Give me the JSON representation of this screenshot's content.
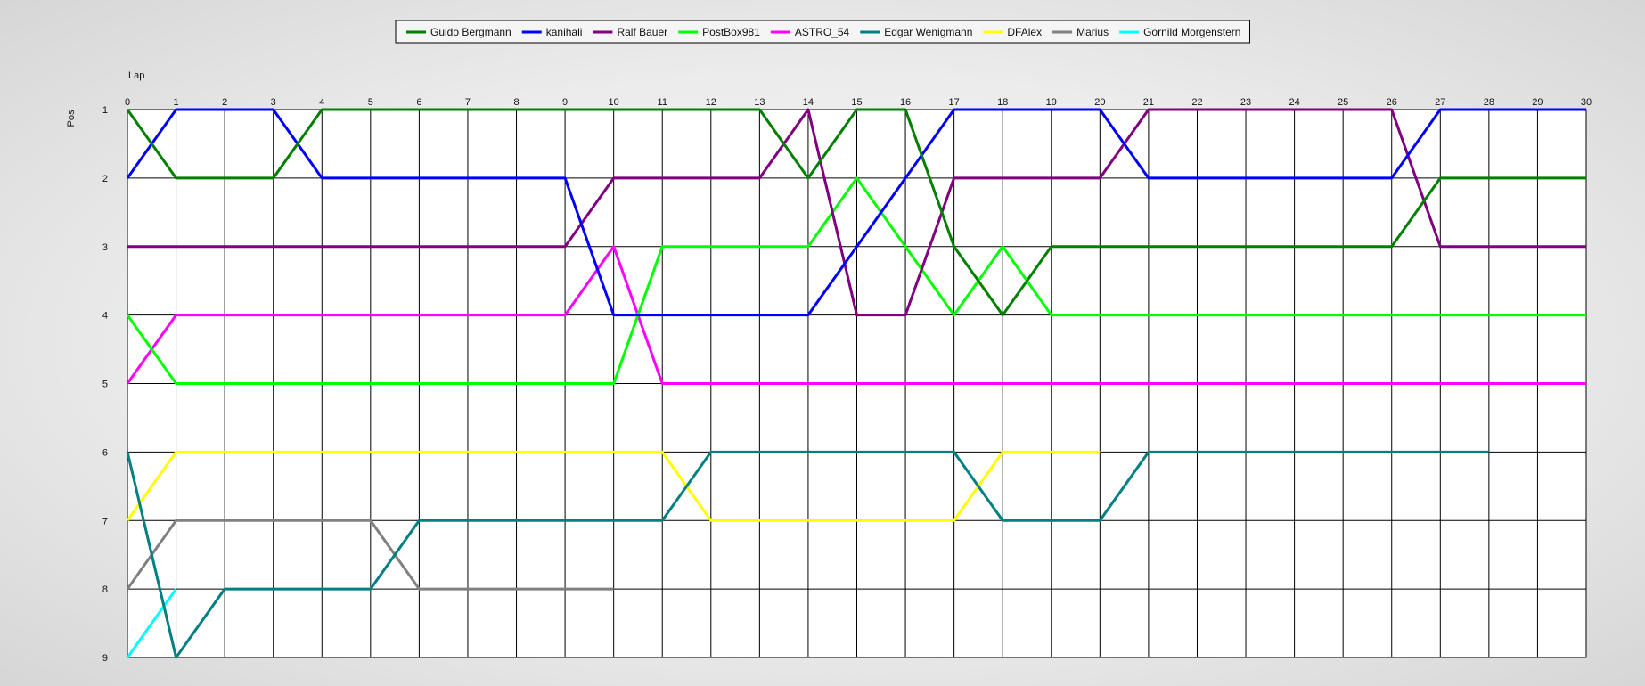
{
  "chart_data": {
    "type": "line",
    "xlabel": "Lap",
    "ylabel": "Pos",
    "xlim": [
      0,
      30
    ],
    "ylim": [
      1,
      9
    ],
    "y_inverted": true,
    "grid": true,
    "legend_position": "top-center",
    "x_ticks": [
      "0",
      "1",
      "2",
      "3",
      "4",
      "5",
      "6",
      "7",
      "8",
      "9",
      "10",
      "11",
      "12",
      "13",
      "14",
      "15",
      "16",
      "17",
      "18",
      "19",
      "20",
      "21",
      "22",
      "23",
      "24",
      "25",
      "26",
      "27",
      "28",
      "29",
      "30"
    ],
    "y_ticks": [
      "1",
      "2",
      "3",
      "4",
      "5",
      "6",
      "7",
      "8",
      "9"
    ],
    "series": [
      {
        "name": "Guido Bergmann",
        "color": "#008000",
        "start_lap": 0,
        "values": [
          1,
          2,
          2,
          2,
          1,
          1,
          1,
          1,
          1,
          1,
          1,
          1,
          1,
          1,
          2,
          1,
          1,
          3,
          4,
          3,
          3,
          3,
          3,
          3,
          3,
          3,
          3,
          2,
          2,
          2,
          2
        ]
      },
      {
        "name": "kanihali",
        "color": "#0000ff",
        "start_lap": 0,
        "values": [
          2,
          1,
          1,
          1,
          2,
          2,
          2,
          2,
          2,
          2,
          4,
          4,
          4,
          4,
          4,
          3,
          2,
          1,
          1,
          1,
          1,
          2,
          2,
          2,
          2,
          2,
          2,
          1,
          1,
          1,
          1
        ]
      },
      {
        "name": "Ralf Bauer",
        "color": "#800080",
        "start_lap": 0,
        "values": [
          3,
          3,
          3,
          3,
          3,
          3,
          3,
          3,
          3,
          3,
          2,
          2,
          2,
          2,
          1,
          4,
          4,
          2,
          2,
          2,
          2,
          1,
          1,
          1,
          1,
          1,
          1,
          3,
          3,
          3,
          3
        ]
      },
      {
        "name": "PostBox981",
        "color": "#00ff00",
        "start_lap": 0,
        "values": [
          4,
          5,
          5,
          5,
          5,
          5,
          5,
          5,
          5,
          5,
          5,
          3,
          3,
          3,
          3,
          2,
          3,
          4,
          3,
          4,
          4,
          4,
          4,
          4,
          4,
          4,
          4,
          4,
          4,
          4,
          4
        ]
      },
      {
        "name": "ASTRO_54",
        "color": "#ff00ff",
        "start_lap": 0,
        "values": [
          5,
          4,
          4,
          4,
          4,
          4,
          4,
          4,
          4,
          4,
          3,
          5,
          5,
          5,
          5,
          5,
          5,
          5,
          5,
          5,
          5,
          5,
          5,
          5,
          5,
          5,
          5,
          5,
          5,
          5,
          5
        ]
      },
      {
        "name": "Edgar Wenigmann",
        "color": "#008080",
        "start_lap": 0,
        "values": [
          6,
          9,
          8,
          8,
          8,
          8,
          7,
          7,
          7,
          7,
          7,
          7,
          6,
          6,
          6,
          6,
          6,
          6,
          7,
          7,
          7,
          6,
          6,
          6,
          6,
          6,
          6,
          6,
          6
        ]
      },
      {
        "name": "DFAlex",
        "color": "#ffff00",
        "start_lap": 0,
        "values": [
          7,
          6,
          6,
          6,
          6,
          6,
          6,
          6,
          6,
          6,
          6,
          6,
          7,
          7,
          7,
          7,
          7,
          7,
          6,
          6,
          6
        ]
      },
      {
        "name": "Marius",
        "color": "#808080",
        "start_lap": 0,
        "values": [
          8,
          7,
          7,
          7,
          7,
          7,
          8,
          8,
          8,
          8,
          8
        ]
      },
      {
        "name": "Gornild Morgenstern",
        "color": "#00ffff",
        "start_lap": 0,
        "values": [
          9,
          8
        ]
      }
    ]
  }
}
